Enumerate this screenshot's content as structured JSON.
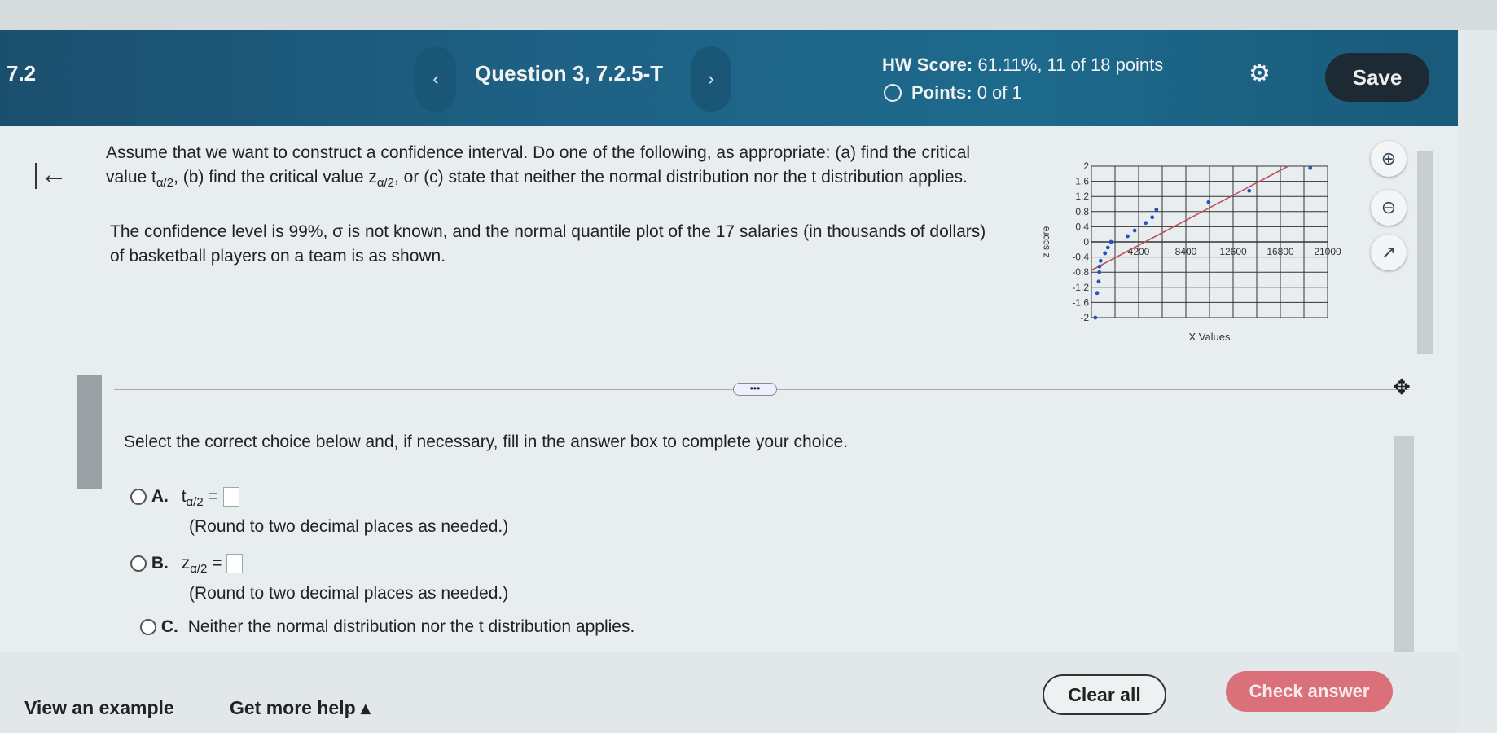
{
  "header": {
    "section": "7.2",
    "question": "Question 3, 7.2.5-T",
    "prev": "‹",
    "next": "›",
    "hw_score_label": "HW Score:",
    "hw_score_value": "61.11%, 11 of 18 points",
    "points_label": "Points:",
    "points_value": "0 of 1",
    "save": "Save"
  },
  "question": {
    "line1": "Assume that we want to construct a confidence interval. Do one of the following, as appropriate: (a) find the critical",
    "line2a": "value t",
    "line2sub1": "α/2",
    "line2b": ", (b) find the critical value z",
    "line2sub2": "α/2",
    "line2c": ", or (c) state that neither the normal distribution nor the t distribution applies.",
    "line3": "The confidence level is 99%, σ is not known, and the normal quantile plot of the 17 salaries (in thousands of dollars)",
    "line4": "of basketball players on a team is as shown."
  },
  "instructions": "Select the correct choice below and, if necessary, fill in the answer box to complete your choice.",
  "options": [
    {
      "letter": "A.",
      "var": "t",
      "sub": "α/2",
      "eq": "=",
      "note": "(Round to two decimal places as needed.)"
    },
    {
      "letter": "B.",
      "var": "z",
      "sub": "α/2",
      "eq": "=",
      "note": "(Round to two decimal places as needed.)"
    },
    {
      "letter": "C.",
      "text": "Neither the normal distribution nor the t distribution applies."
    }
  ],
  "footer": {
    "example": "View an example",
    "help": "Get more help ▴",
    "clear": "Clear all",
    "check": "Check answer"
  },
  "colors": {
    "header": "#1e6286",
    "check": "#d9707a",
    "line": "#c0505a",
    "points": "#2a4fc0"
  },
  "chart_data": {
    "type": "scatter",
    "xlabel": "X Values",
    "ylabel": "z score",
    "xlim": [
      0,
      21000
    ],
    "ylim": [
      -2,
      2
    ],
    "xticks": [
      4200,
      8400,
      12600,
      16800,
      21000
    ],
    "yticks": [
      2,
      1.6,
      1.2,
      0.8,
      0.4,
      0,
      -0.4,
      -0.8,
      -1.2,
      -1.6,
      -2
    ],
    "grid": true,
    "points": [
      [
        350,
        -2
      ],
      [
        510,
        -1.35
      ],
      [
        650,
        -1.05
      ],
      [
        700,
        -0.8
      ],
      [
        720,
        -0.65
      ],
      [
        820,
        -0.5
      ],
      [
        1210,
        -0.3
      ],
      [
        1470,
        -0.15
      ],
      [
        1750,
        0
      ],
      [
        3220,
        0.15
      ],
      [
        3850,
        0.3
      ],
      [
        4830,
        0.5
      ],
      [
        5410,
        0.65
      ],
      [
        5780,
        0.85
      ],
      [
        10420,
        1.05
      ],
      [
        14030,
        1.35
      ],
      [
        19460,
        1.95
      ]
    ],
    "line": [
      [
        0,
        -0.75
      ],
      [
        17500,
        2
      ]
    ]
  }
}
